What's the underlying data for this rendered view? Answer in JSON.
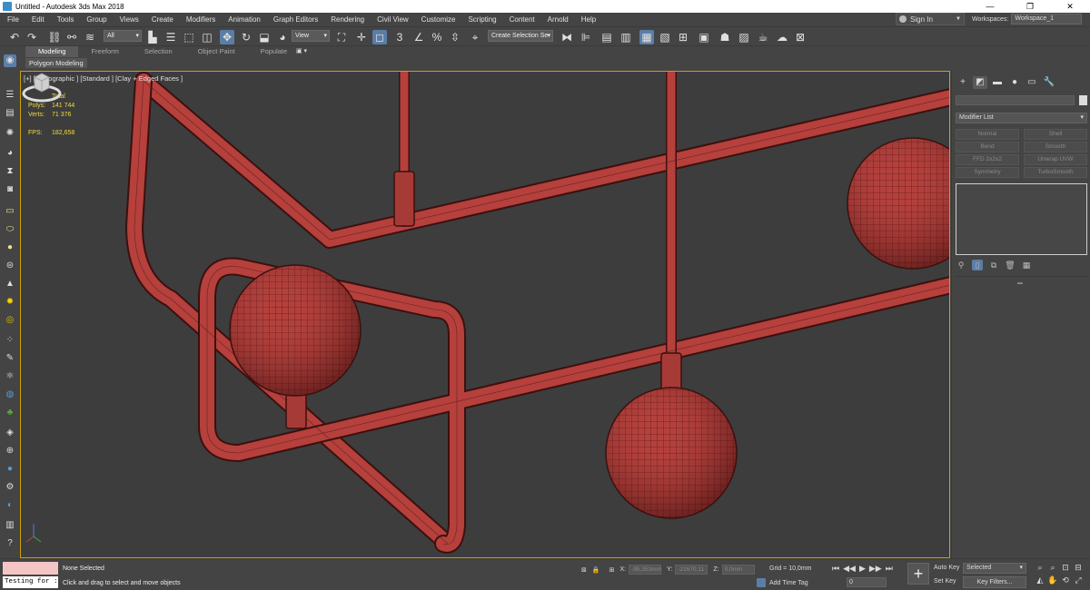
{
  "window": {
    "title": "Untitled - Autodesk 3ds Max 2018",
    "controls": [
      "—",
      "❐",
      "✕"
    ]
  },
  "menu": [
    "File",
    "Edit",
    "Tools",
    "Group",
    "Views",
    "Create",
    "Modifiers",
    "Animation",
    "Graph Editors",
    "Rendering",
    "Civil View",
    "Customize",
    "Scripting",
    "Content",
    "Arnold",
    "Help"
  ],
  "account": {
    "sign_in": "Sign In",
    "workspaces_label": "Workspaces:",
    "workspace_value": "Workspace_1"
  },
  "toolbar": {
    "selection_filter": "All",
    "reference_coord": "View",
    "named_selection": "Create Selection Se"
  },
  "ribbon": {
    "tabs": [
      "Modeling",
      "Freeform",
      "Selection",
      "Object Paint",
      "Populate"
    ],
    "active_tab": "Modeling",
    "subtitle": "Polygon Modeling",
    "options": "▣ ▾"
  },
  "viewport": {
    "label": "[+] [Orthographic ] [Standard ] [Clay + Edged Faces ]",
    "stats": {
      "header": "Total",
      "polys_label": "Polys:",
      "polys_value": "141 744",
      "verts_label": "Verts:",
      "verts_value": "71 376",
      "fps_label": "FPS:",
      "fps_value": "182,658"
    },
    "mesh_color": "#b5403c",
    "border_color": "#c9a300"
  },
  "command_panel": {
    "modifier_list": "Modifier List",
    "modifiers": [
      "Normal",
      "Shell",
      "Bend",
      "Smooth",
      "FFD 2x2x2",
      "Unwrap UVW",
      "Symmetry",
      "TurboSmooth"
    ]
  },
  "status": {
    "maxscript_input": "Testing for :",
    "selection": "None Selected",
    "prompt": "Click and drag to select and move objects",
    "x_label": "X:",
    "x_value": "-95,353mm",
    "y_label": "Y:",
    "y_value": "-21670,11",
    "z_label": "Z:",
    "z_value": "0,0mm",
    "grid": "Grid = 10,0mm",
    "add_time_tag": "Add Time Tag",
    "frame": "0",
    "auto_key": "Auto Key",
    "set_key": "Set Key",
    "key_mode": "Selected",
    "key_filters": "Key Filters..."
  }
}
